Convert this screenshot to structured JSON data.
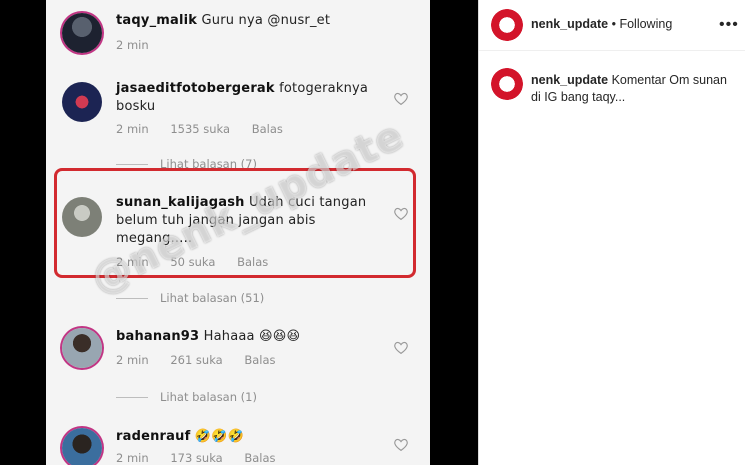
{
  "comments": [
    {
      "user": "taqy_malik",
      "text": "Guru nya",
      "mention": "@nusr_et",
      "time": "2 min"
    },
    {
      "user": "jasaeditfotobergerak",
      "text": "fotogeraknya bosku",
      "time": "2 min",
      "likes": "1535 suka",
      "reply": "Balas",
      "view_replies": "Lihat balasan (7)"
    },
    {
      "user": "sunan_kalijagash",
      "text": "Udah cuci tangan belum tuh jangan jangan abis megang.....",
      "time": "2 min",
      "likes": "50 suka",
      "reply": "Balas",
      "view_replies": "Lihat balasan (51)"
    },
    {
      "user": "bahanan93",
      "text": "Hahaaa 😆😆😆",
      "time": "2 min",
      "likes": "261 suka",
      "reply": "Balas",
      "view_replies": "Lihat balasan (1)"
    },
    {
      "user": "radenrauf",
      "text": "🤣🤣🤣",
      "time": "2 min",
      "likes": "173 suka",
      "reply": "Balas"
    }
  ],
  "watermark": "@nenk_update",
  "post": {
    "username": "nenk_update",
    "separator": "•",
    "follow_status": "Following",
    "more": "•••",
    "caption_user": "nenk_update",
    "caption": "Komentar Om sunan di IG bang taqy..."
  }
}
